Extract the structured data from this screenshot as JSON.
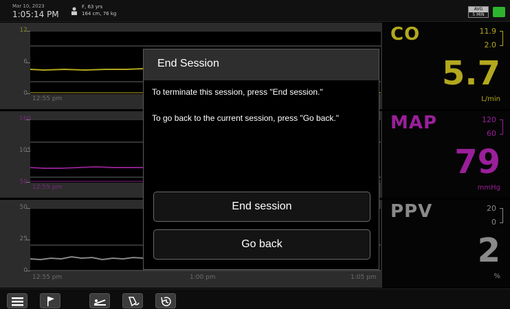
{
  "status_bar": {
    "date": "Mar 10, 2023",
    "time": "1:05:14 PM",
    "patient_line1": "F, 63 yrs",
    "patient_line2": "164 cm, 76 kg",
    "avg_top": "AVG",
    "avg_bottom": "5 MIN"
  },
  "charts": {
    "co": {
      "y_max": "12",
      "y_mid": "6",
      "y_min": "0",
      "x_start": "12:55 pm",
      "color": "#b3a81e"
    },
    "map": {
      "y_max": "160",
      "y_mid": "105",
      "y_min": "50",
      "x_start": "12:55 pm",
      "color": "#8a1f8a"
    },
    "ppv": {
      "y_max": "50",
      "y_mid": "25",
      "y_min": "0",
      "x_start": "12:55 pm",
      "x_mid": "1:00 pm",
      "x_end": "1:05 pm",
      "color": "#7a7a7a"
    }
  },
  "params": {
    "co": {
      "name": "CO",
      "high": "11.9",
      "low": "2.0",
      "value": "5.7",
      "unit": "L/min",
      "color": "#b3a81e"
    },
    "map": {
      "name": "MAP",
      "high": "120",
      "low": "60",
      "value": "79",
      "unit": "mmHg",
      "color": "#9a1f9a"
    },
    "ppv": {
      "name": "PPV",
      "high": "20",
      "low": "0",
      "value": "2",
      "unit": "%",
      "color": "#8a8a8a"
    }
  },
  "modal": {
    "title": "End Session",
    "text1": "To terminate this session, press \"End session.\"",
    "text2": "To go back to the current session, press \"Go back.\"",
    "end_button": "End session",
    "back_button": "Go back"
  },
  "toolbar": {
    "icons": [
      "menu-icon",
      "flag-icon",
      "patient-bed-icon",
      "probe-icon",
      "history-icon"
    ]
  }
}
